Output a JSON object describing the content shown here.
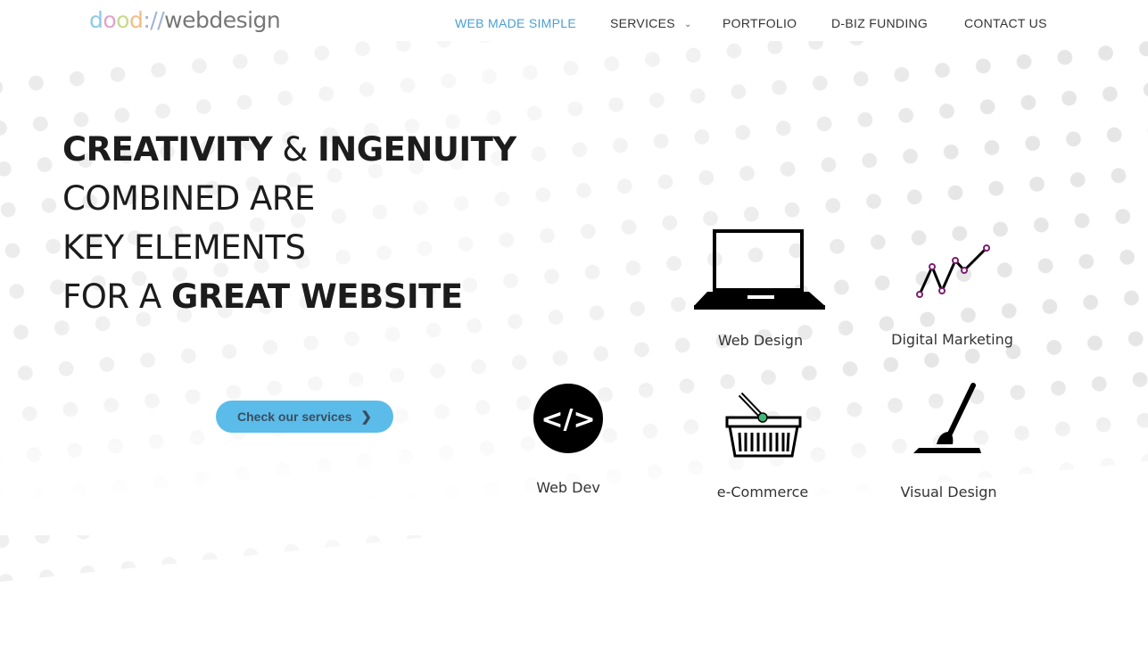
{
  "logo": {
    "part1": "dood",
    "separator": "://",
    "part2": "webdesign"
  },
  "nav": {
    "items": [
      {
        "label": "WEB MADE SIMPLE",
        "active": true
      },
      {
        "label": "SERVICES",
        "has_dropdown": true
      },
      {
        "label": "PORTFOLIO"
      },
      {
        "label": "D-BIZ FUNDING"
      },
      {
        "label": "CONTACT US"
      }
    ]
  },
  "hero": {
    "line1_bold_a": "CREATIVITY",
    "line1_amp": "&",
    "line1_bold_b": "INGENUITY",
    "line2": "COMBINED ARE",
    "line3": "KEY ELEMENTS",
    "line4_prefix": "FOR A",
    "line4_bold": "GREAT WEBSITE"
  },
  "cta": {
    "label": "Check our services",
    "icon": "chevron-right-icon"
  },
  "services": [
    {
      "label": "Web Design",
      "icon": "laptop-icon"
    },
    {
      "label": "Digital Marketing",
      "icon": "line-graph-icon"
    },
    {
      "label": "Web Dev",
      "icon": "code-icon"
    },
    {
      "label": "e-Commerce",
      "icon": "shopping-basket-icon"
    },
    {
      "label": "Visual Design",
      "icon": "paintbrush-icon"
    }
  ],
  "colors": {
    "accent": "#4a9fd5",
    "cta_bg": "#5bbcea",
    "graph_dots": "#7b1f6e",
    "basket_dot": "#3cb878"
  }
}
